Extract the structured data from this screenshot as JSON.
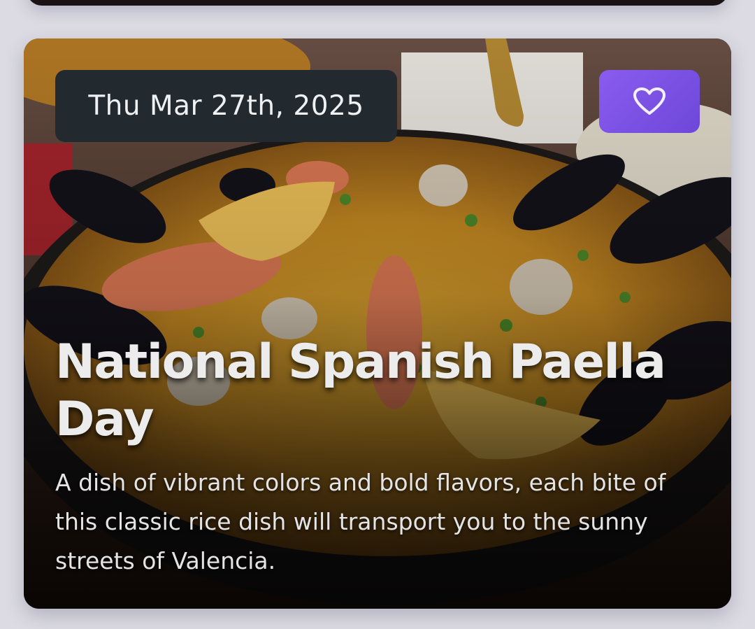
{
  "card": {
    "date": "Thu Mar 27th, 2025",
    "title": "National Spanish Paella Day",
    "description": "A dish of vibrant colors and bold flavors, each bite of this classic rice dish will transport you to the sunny streets of Valencia.",
    "favorite_icon": "heart-outline-icon",
    "image": "paella-photo"
  },
  "colors": {
    "background": "#dcdbe3",
    "date_badge": "#22292f",
    "favorite_button": "#7c52e6",
    "title_text": "#ececec"
  }
}
